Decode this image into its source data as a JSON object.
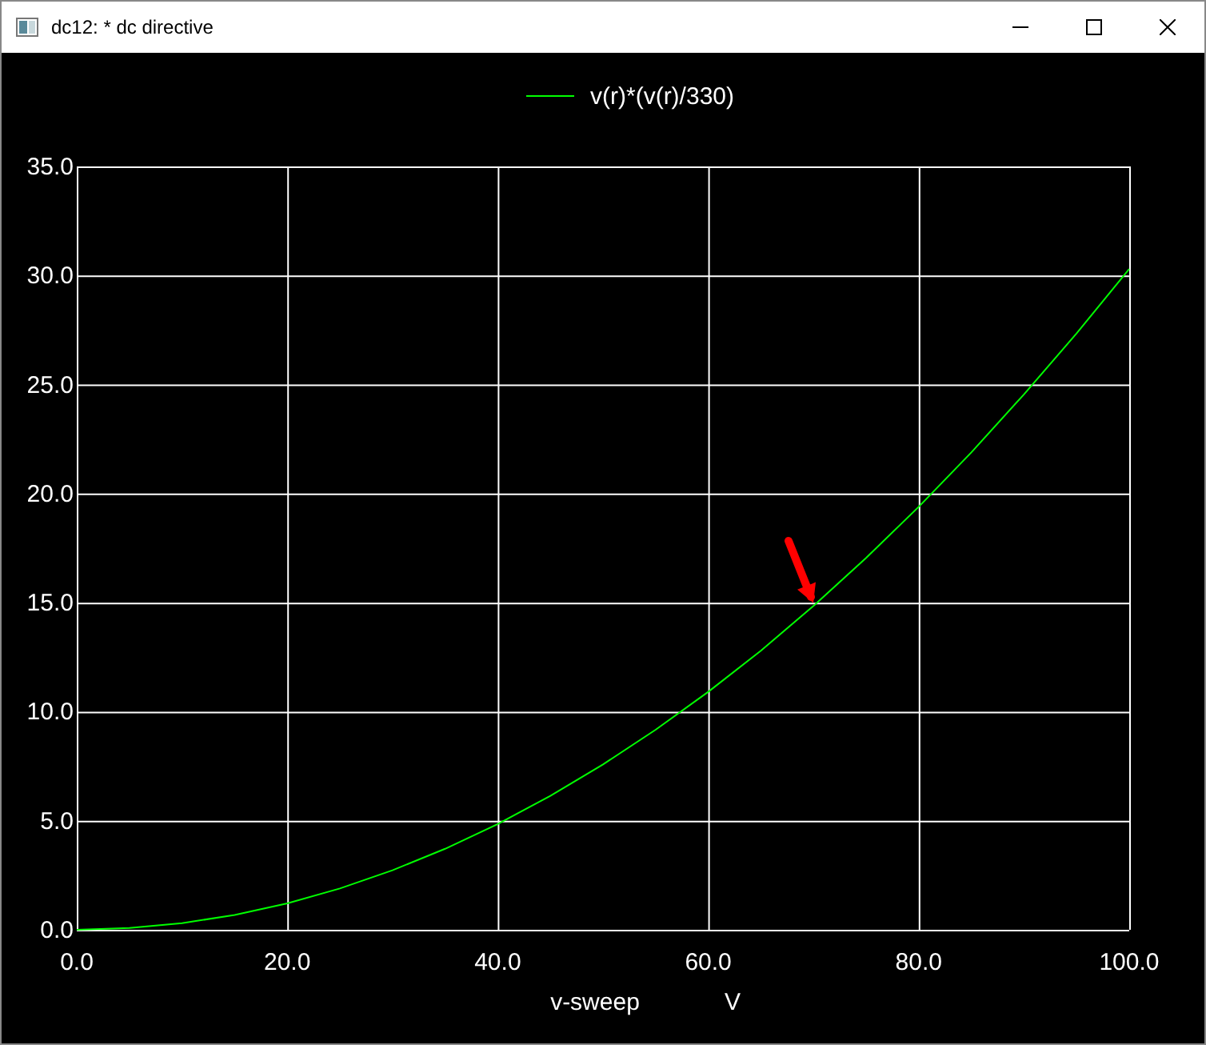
{
  "window": {
    "title": "dc12: * dc directive"
  },
  "plot": {
    "unit_label": "V",
    "marker": {
      "kind": "arrow"
    },
    "chart_data": {
      "type": "line",
      "xlabel": "v-sweep",
      "xlim": [
        0,
        100
      ],
      "ylim": [
        0,
        35
      ],
      "grid": true,
      "x": [
        0,
        5,
        10,
        15,
        20,
        25,
        30,
        35,
        40,
        45,
        50,
        55,
        60,
        65,
        70,
        75,
        80,
        85,
        90,
        95,
        100
      ],
      "series": [
        {
          "name": "v(r)*(v(r)/330)",
          "color": "#00ff00",
          "values": [
            0,
            0.08,
            0.3,
            0.68,
            1.21,
            1.89,
            2.73,
            3.71,
            4.85,
            6.14,
            7.58,
            9.17,
            10.91,
            12.8,
            14.85,
            17.05,
            19.39,
            21.89,
            24.55,
            27.35,
            30.3
          ]
        }
      ],
      "xticks": [
        {
          "value": 0,
          "label": "0.0"
        },
        {
          "value": 20,
          "label": "20.0"
        },
        {
          "value": 40,
          "label": "40.0"
        },
        {
          "value": 60,
          "label": "60.0"
        },
        {
          "value": 80,
          "label": "80.0"
        },
        {
          "value": 100,
          "label": "100.0"
        }
      ],
      "yticks": [
        {
          "value": 0,
          "label": "0.0"
        },
        {
          "value": 5,
          "label": "5.0"
        },
        {
          "value": 10,
          "label": "10.0"
        },
        {
          "value": 15,
          "label": "15.0"
        },
        {
          "value": 20,
          "label": "20.0"
        },
        {
          "value": 25,
          "label": "25.0"
        },
        {
          "value": 30,
          "label": "30.0"
        },
        {
          "value": 35,
          "label": "35.0"
        }
      ]
    }
  }
}
